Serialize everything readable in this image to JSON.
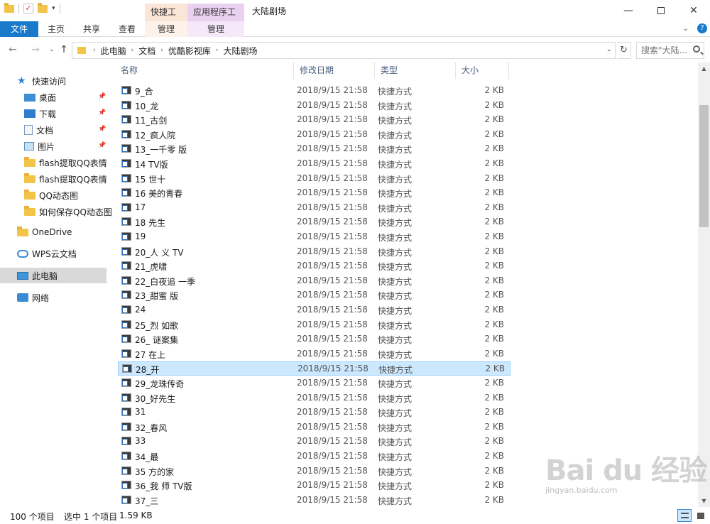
{
  "window": {
    "title": "大陆剧场",
    "context_tab_shortcut": "快捷工具",
    "context_tab_app": "应用程序工具"
  },
  "ribbon": {
    "tabs": [
      {
        "label": "文件"
      },
      {
        "label": "主页"
      },
      {
        "label": "共享"
      },
      {
        "label": "查看"
      },
      {
        "label": "管理"
      },
      {
        "label": "管理"
      }
    ]
  },
  "address": {
    "crumbs": [
      "此电脑",
      "文档",
      "优酷影视库",
      "大陆剧场"
    ],
    "search_placeholder": "搜索\"大陆..."
  },
  "navpane": {
    "items": [
      {
        "label": "快速访问",
        "icon": "star-icon",
        "pinned": false
      },
      {
        "label": "桌面",
        "icon": "desktop-icon",
        "pinned": true
      },
      {
        "label": "下载",
        "icon": "download-icon",
        "pinned": true
      },
      {
        "label": "文档",
        "icon": "document-icon",
        "pinned": true
      },
      {
        "label": "图片",
        "icon": "picture-icon",
        "pinned": true
      },
      {
        "label": "flash提取QQ表情",
        "icon": "folder-icon",
        "pinned": false
      },
      {
        "label": "flash提取QQ表情",
        "icon": "folder-icon",
        "pinned": false
      },
      {
        "label": "QQ动态图",
        "icon": "folder-icon",
        "pinned": false
      },
      {
        "label": "如何保存QQ动态图",
        "icon": "folder-icon",
        "pinned": false
      },
      {
        "label": "OneDrive",
        "icon": "onedrive-folder-icon",
        "pinned": false
      },
      {
        "label": "WPS云文档",
        "icon": "cloud-icon",
        "pinned": false
      },
      {
        "label": "此电脑",
        "icon": "computer-icon",
        "pinned": false
      },
      {
        "label": "网络",
        "icon": "network-icon",
        "pinned": false
      }
    ]
  },
  "columns": {
    "name": "名称",
    "date": "修改日期",
    "type": "类型",
    "size": "大小"
  },
  "files": [
    {
      "name": "9_合",
      "date": "2018/9/15 21:58",
      "type": "快捷方式",
      "size": "2 KB"
    },
    {
      "name": "10_龙",
      "date": "2018/9/15 21:58",
      "type": "快捷方式",
      "size": "2 KB"
    },
    {
      "name": "11_古剑",
      "date": "2018/9/15 21:58",
      "type": "快捷方式",
      "size": "2 KB"
    },
    {
      "name": "12_疯人院",
      "date": "2018/9/15 21:58",
      "type": "快捷方式",
      "size": "2 KB"
    },
    {
      "name": "13_一千零  版",
      "date": "2018/9/15 21:58",
      "type": "快捷方式",
      "size": "2 KB"
    },
    {
      "name": "14  TV版",
      "date": "2018/9/15 21:58",
      "type": "快捷方式",
      "size": "2 KB"
    },
    {
      "name": "15  世十",
      "date": "2018/9/15 21:58",
      "type": "快捷方式",
      "size": "2 KB"
    },
    {
      "name": "16  美的青春",
      "date": "2018/9/15 21:58",
      "type": "快捷方式",
      "size": "2 KB"
    },
    {
      "name": "17",
      "date": "2018/9/15 21:58",
      "type": "快捷方式",
      "size": "2 KB"
    },
    {
      "name": "18  先生",
      "date": "2018/9/15 21:58",
      "type": "快捷方式",
      "size": "2 KB"
    },
    {
      "name": "19",
      "date": "2018/9/15 21:58",
      "type": "快捷方式",
      "size": "2 KB"
    },
    {
      "name": "20_人  义 TV",
      "date": "2018/9/15 21:58",
      "type": "快捷方式",
      "size": "2 KB"
    },
    {
      "name": "21_虎啸",
      "date": "2018/9/15 21:58",
      "type": "快捷方式",
      "size": "2 KB"
    },
    {
      "name": "22_白夜追  一季",
      "date": "2018/9/15 21:58",
      "type": "快捷方式",
      "size": "2 KB"
    },
    {
      "name": "23_甜蜜  版",
      "date": "2018/9/15 21:58",
      "type": "快捷方式",
      "size": "2 KB"
    },
    {
      "name": "24",
      "date": "2018/9/15 21:58",
      "type": "快捷方式",
      "size": "2 KB"
    },
    {
      "name": "25_烈  如歌",
      "date": "2018/9/15 21:58",
      "type": "快捷方式",
      "size": "2 KB"
    },
    {
      "name": "26_  谜案集",
      "date": "2018/9/15 21:58",
      "type": "快捷方式",
      "size": "2 KB"
    },
    {
      "name": "27  在上",
      "date": "2018/9/15 21:58",
      "type": "快捷方式",
      "size": "2 KB"
    },
    {
      "name": "28_开",
      "date": "2018/9/15 21:58",
      "type": "快捷方式",
      "size": "2 KB",
      "selected": true
    },
    {
      "name": "29_龙珠传奇",
      "date": "2018/9/15 21:58",
      "type": "快捷方式",
      "size": "2 KB"
    },
    {
      "name": "30_好先生",
      "date": "2018/9/15 21:58",
      "type": "快捷方式",
      "size": "2 KB"
    },
    {
      "name": "31",
      "date": "2018/9/15 21:58",
      "type": "快捷方式",
      "size": "2 KB"
    },
    {
      "name": "32_春风",
      "date": "2018/9/15 21:58",
      "type": "快捷方式",
      "size": "2 KB"
    },
    {
      "name": "33",
      "date": "2018/9/15 21:58",
      "type": "快捷方式",
      "size": "2 KB"
    },
    {
      "name": "34_最",
      "date": "2018/9/15 21:58",
      "type": "快捷方式",
      "size": "2 KB"
    },
    {
      "name": "35  方的家",
      "date": "2018/9/15 21:58",
      "type": "快捷方式",
      "size": "2 KB"
    },
    {
      "name": "36_我  师 TV版",
      "date": "2018/9/15 21:58",
      "type": "快捷方式",
      "size": "2 KB"
    },
    {
      "name": "37_三",
      "date": "2018/9/15 21:58",
      "type": "快捷方式",
      "size": "2 KB"
    }
  ],
  "status": {
    "count": "100 个项目",
    "selected": "选中 1 个项目",
    "size": "1.59 KB"
  },
  "watermark": {
    "text": "Bai du 经验",
    "url": "jingyan.baidu.com"
  },
  "colors": {
    "file_tab": "#1979ca",
    "selection_bg": "#cce8ff",
    "selection_border": "#99d1ff",
    "context_shortcut_bg": "#fbe5d6",
    "context_app_bg": "#ead1f2"
  }
}
